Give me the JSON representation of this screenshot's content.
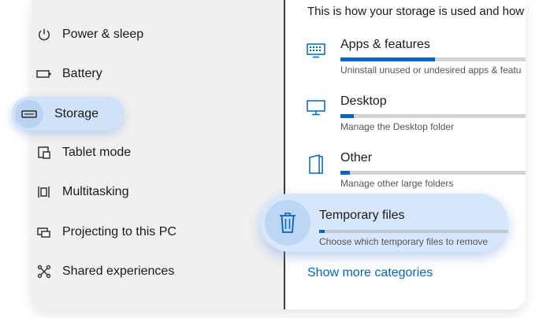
{
  "sidebar": {
    "items": [
      {
        "label": "Power & sleep",
        "icon": "power-icon"
      },
      {
        "label": "Battery",
        "icon": "battery-icon"
      },
      {
        "label": "Storage",
        "icon": "storage-drive-icon",
        "selected": true
      },
      {
        "label": "Tablet mode",
        "icon": "tablet-mode-icon"
      },
      {
        "label": "Multitasking",
        "icon": "multitasking-icon"
      },
      {
        "label": "Projecting to this PC",
        "icon": "projecting-icon"
      },
      {
        "label": "Shared experiences",
        "icon": "shared-experiences-icon"
      }
    ]
  },
  "main": {
    "header": "This is how your storage is used and how",
    "categories": [
      {
        "title": "Apps & features",
        "description": "Uninstall unused or undesired apps & featu",
        "usage_fraction": 0.5,
        "icon": "apps-features-icon"
      },
      {
        "title": "Desktop",
        "description": "Manage the Desktop folder",
        "usage_fraction": 0.07,
        "icon": "desktop-icon"
      },
      {
        "title": "Other",
        "description": "Manage other large folders",
        "usage_fraction": 0.05,
        "icon": "folder-icon"
      },
      {
        "title": "Temporary files",
        "description": "Choose which temporary files to remove",
        "usage_fraction": 0.03,
        "icon": "trash-icon",
        "highlighted": true
      }
    ],
    "show_more": "Show more categories"
  },
  "colors": {
    "accent": "#0067c0",
    "highlight": "#d6e7fb",
    "sidebar_bg": "#f0f0f0",
    "content_bg": "#ffffff"
  }
}
